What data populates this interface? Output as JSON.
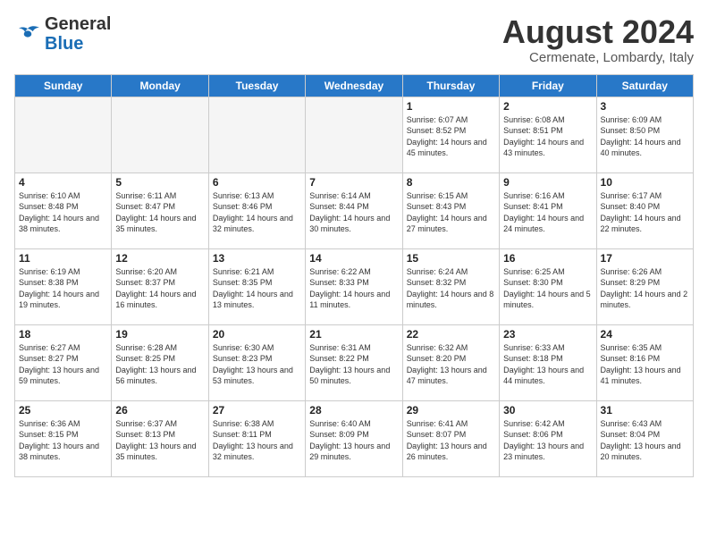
{
  "header": {
    "logo_line1": "General",
    "logo_line2": "Blue",
    "month": "August 2024",
    "location": "Cermenate, Lombardy, Italy"
  },
  "weekdays": [
    "Sunday",
    "Monday",
    "Tuesday",
    "Wednesday",
    "Thursday",
    "Friday",
    "Saturday"
  ],
  "weeks": [
    [
      {
        "day": "",
        "text": "",
        "empty": true
      },
      {
        "day": "",
        "text": "",
        "empty": true
      },
      {
        "day": "",
        "text": "",
        "empty": true
      },
      {
        "day": "",
        "text": "",
        "empty": true
      },
      {
        "day": "1",
        "text": "Sunrise: 6:07 AM\nSunset: 8:52 PM\nDaylight: 14 hours\nand 45 minutes.",
        "empty": false
      },
      {
        "day": "2",
        "text": "Sunrise: 6:08 AM\nSunset: 8:51 PM\nDaylight: 14 hours\nand 43 minutes.",
        "empty": false
      },
      {
        "day": "3",
        "text": "Sunrise: 6:09 AM\nSunset: 8:50 PM\nDaylight: 14 hours\nand 40 minutes.",
        "empty": false
      }
    ],
    [
      {
        "day": "4",
        "text": "Sunrise: 6:10 AM\nSunset: 8:48 PM\nDaylight: 14 hours\nand 38 minutes.",
        "empty": false
      },
      {
        "day": "5",
        "text": "Sunrise: 6:11 AM\nSunset: 8:47 PM\nDaylight: 14 hours\nand 35 minutes.",
        "empty": false
      },
      {
        "day": "6",
        "text": "Sunrise: 6:13 AM\nSunset: 8:46 PM\nDaylight: 14 hours\nand 32 minutes.",
        "empty": false
      },
      {
        "day": "7",
        "text": "Sunrise: 6:14 AM\nSunset: 8:44 PM\nDaylight: 14 hours\nand 30 minutes.",
        "empty": false
      },
      {
        "day": "8",
        "text": "Sunrise: 6:15 AM\nSunset: 8:43 PM\nDaylight: 14 hours\nand 27 minutes.",
        "empty": false
      },
      {
        "day": "9",
        "text": "Sunrise: 6:16 AM\nSunset: 8:41 PM\nDaylight: 14 hours\nand 24 minutes.",
        "empty": false
      },
      {
        "day": "10",
        "text": "Sunrise: 6:17 AM\nSunset: 8:40 PM\nDaylight: 14 hours\nand 22 minutes.",
        "empty": false
      }
    ],
    [
      {
        "day": "11",
        "text": "Sunrise: 6:19 AM\nSunset: 8:38 PM\nDaylight: 14 hours\nand 19 minutes.",
        "empty": false
      },
      {
        "day": "12",
        "text": "Sunrise: 6:20 AM\nSunset: 8:37 PM\nDaylight: 14 hours\nand 16 minutes.",
        "empty": false
      },
      {
        "day": "13",
        "text": "Sunrise: 6:21 AM\nSunset: 8:35 PM\nDaylight: 14 hours\nand 13 minutes.",
        "empty": false
      },
      {
        "day": "14",
        "text": "Sunrise: 6:22 AM\nSunset: 8:33 PM\nDaylight: 14 hours\nand 11 minutes.",
        "empty": false
      },
      {
        "day": "15",
        "text": "Sunrise: 6:24 AM\nSunset: 8:32 PM\nDaylight: 14 hours\nand 8 minutes.",
        "empty": false
      },
      {
        "day": "16",
        "text": "Sunrise: 6:25 AM\nSunset: 8:30 PM\nDaylight: 14 hours\nand 5 minutes.",
        "empty": false
      },
      {
        "day": "17",
        "text": "Sunrise: 6:26 AM\nSunset: 8:29 PM\nDaylight: 14 hours\nand 2 minutes.",
        "empty": false
      }
    ],
    [
      {
        "day": "18",
        "text": "Sunrise: 6:27 AM\nSunset: 8:27 PM\nDaylight: 13 hours\nand 59 minutes.",
        "empty": false
      },
      {
        "day": "19",
        "text": "Sunrise: 6:28 AM\nSunset: 8:25 PM\nDaylight: 13 hours\nand 56 minutes.",
        "empty": false
      },
      {
        "day": "20",
        "text": "Sunrise: 6:30 AM\nSunset: 8:23 PM\nDaylight: 13 hours\nand 53 minutes.",
        "empty": false
      },
      {
        "day": "21",
        "text": "Sunrise: 6:31 AM\nSunset: 8:22 PM\nDaylight: 13 hours\nand 50 minutes.",
        "empty": false
      },
      {
        "day": "22",
        "text": "Sunrise: 6:32 AM\nSunset: 8:20 PM\nDaylight: 13 hours\nand 47 minutes.",
        "empty": false
      },
      {
        "day": "23",
        "text": "Sunrise: 6:33 AM\nSunset: 8:18 PM\nDaylight: 13 hours\nand 44 minutes.",
        "empty": false
      },
      {
        "day": "24",
        "text": "Sunrise: 6:35 AM\nSunset: 8:16 PM\nDaylight: 13 hours\nand 41 minutes.",
        "empty": false
      }
    ],
    [
      {
        "day": "25",
        "text": "Sunrise: 6:36 AM\nSunset: 8:15 PM\nDaylight: 13 hours\nand 38 minutes.",
        "empty": false
      },
      {
        "day": "26",
        "text": "Sunrise: 6:37 AM\nSunset: 8:13 PM\nDaylight: 13 hours\nand 35 minutes.",
        "empty": false
      },
      {
        "day": "27",
        "text": "Sunrise: 6:38 AM\nSunset: 8:11 PM\nDaylight: 13 hours\nand 32 minutes.",
        "empty": false
      },
      {
        "day": "28",
        "text": "Sunrise: 6:40 AM\nSunset: 8:09 PM\nDaylight: 13 hours\nand 29 minutes.",
        "empty": false
      },
      {
        "day": "29",
        "text": "Sunrise: 6:41 AM\nSunset: 8:07 PM\nDaylight: 13 hours\nand 26 minutes.",
        "empty": false
      },
      {
        "day": "30",
        "text": "Sunrise: 6:42 AM\nSunset: 8:06 PM\nDaylight: 13 hours\nand 23 minutes.",
        "empty": false
      },
      {
        "day": "31",
        "text": "Sunrise: 6:43 AM\nSunset: 8:04 PM\nDaylight: 13 hours\nand 20 minutes.",
        "empty": false
      }
    ]
  ]
}
